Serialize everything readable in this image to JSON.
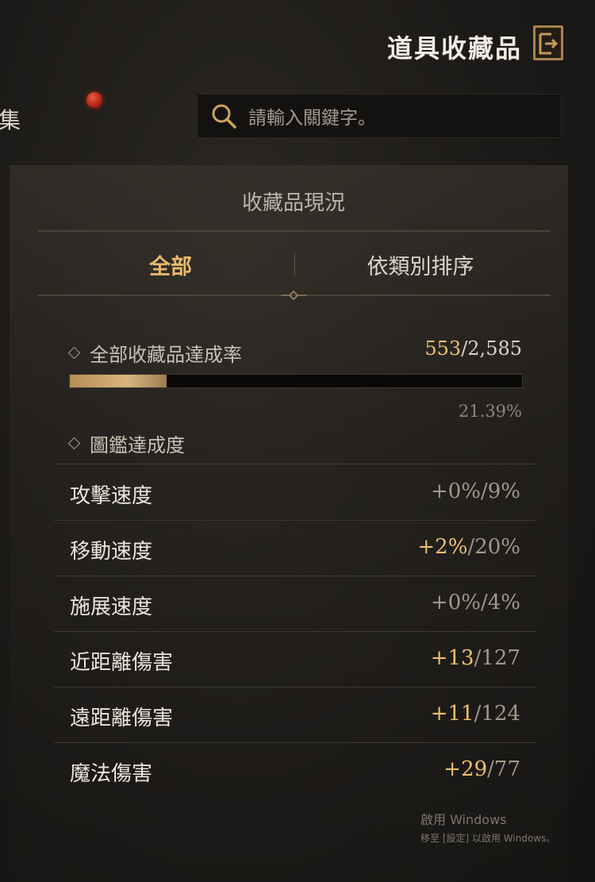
{
  "header": {
    "title": "道具收藏品",
    "exit_icon": "exit-icon"
  },
  "left_tab": {
    "label": "集"
  },
  "search": {
    "placeholder": "請輸入關鍵字。",
    "icon": "search-icon"
  },
  "panel": {
    "title": "收藏品現況",
    "tabs": [
      {
        "label": "全部",
        "active": true
      },
      {
        "label": "依類別排序",
        "active": false
      }
    ]
  },
  "collection_rate": {
    "label": "全部收藏品達成率",
    "collected": "553",
    "total": "/2,585",
    "percent": "21.39%",
    "progress_fraction": 0.2139
  },
  "codex": {
    "label": "圖鑑達成度"
  },
  "stats": [
    {
      "name": "攻擊速度",
      "bonus": "+0%",
      "max": "/9%",
      "highlight": false
    },
    {
      "name": "移動速度",
      "bonus": "+2%",
      "max": "/20%",
      "highlight": true
    },
    {
      "name": "施展速度",
      "bonus": "+0%",
      "max": "/4%",
      "highlight": false
    },
    {
      "name": "近距離傷害",
      "bonus": "+13",
      "max": "/127",
      "highlight": true
    },
    {
      "name": "遠距離傷害",
      "bonus": "+11",
      "max": "/124",
      "highlight": true
    },
    {
      "name": "魔法傷害",
      "bonus": "+29",
      "max": "/77",
      "highlight": true
    }
  ],
  "watermark": {
    "line1": "啟用 Windows",
    "line2": "移至 [設定] 以啟用 Windows。"
  },
  "colors": {
    "accent": "#f0be6e",
    "panel_bg": "#2b2824",
    "notification": "#d2301c"
  }
}
